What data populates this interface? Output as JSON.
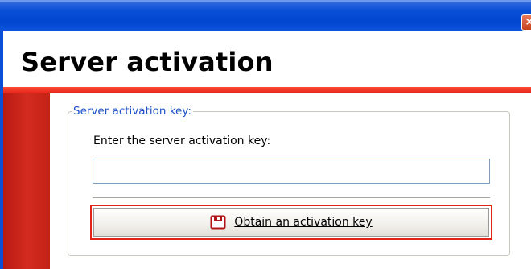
{
  "window": {
    "close_glyph": "×"
  },
  "header": {
    "title": "Server activation"
  },
  "form": {
    "group_legend": "Server activation key:",
    "prompt": "Enter the server activation key:",
    "key_value": "",
    "obtain_label": "Obtain an activation key",
    "obtain_icon": "key-card-icon"
  },
  "colors": {
    "titlebar_blue": "#0a4fd6",
    "accent_red": "#e2231a",
    "legend_blue": "#1f50c8"
  }
}
